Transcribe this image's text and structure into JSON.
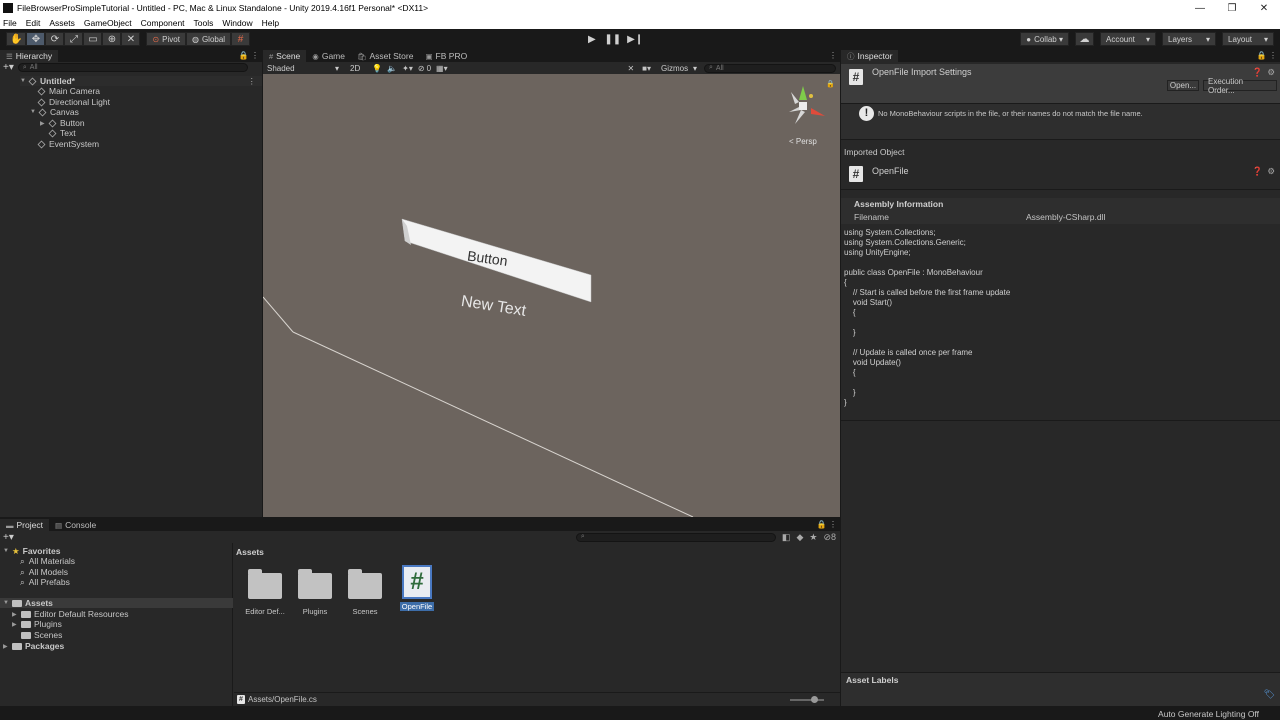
{
  "window": {
    "title": "FileBrowserProSimpleTutorial - Untitled - PC, Mac & Linux Standalone - Unity 2019.4.16f1 Personal* <DX11>",
    "minimize": "—",
    "restore": "❐",
    "close": "✕"
  },
  "menu": [
    "File",
    "Edit",
    "Assets",
    "GameObject",
    "Component",
    "Tools",
    "Window",
    "Help"
  ],
  "toolbar": {
    "pivot": "Pivot",
    "global": "Global",
    "collab": "Collab",
    "account": "Account",
    "layers": "Layers",
    "layout": "Layout"
  },
  "hierarchy": {
    "tab": "Hierarchy",
    "search_placeholder": "All",
    "items": [
      {
        "label": "Untitled*",
        "depth": 0
      },
      {
        "label": "Main Camera",
        "depth": 1
      },
      {
        "label": "Directional Light",
        "depth": 1
      },
      {
        "label": "Canvas",
        "depth": 1
      },
      {
        "label": "Button",
        "depth": 2
      },
      {
        "label": "Text",
        "depth": 2
      },
      {
        "label": "EventSystem",
        "depth": 1
      }
    ]
  },
  "scene": {
    "tabs": [
      "Scene",
      "Game",
      "Asset Store",
      "FB PRO"
    ],
    "shading": "Shaded",
    "mode_2d": "2D",
    "hidden_count": "0",
    "gizmos": "Gizmos",
    "search_placeholder": "All",
    "persp": "< Persp",
    "button_label": "Button",
    "text_label": "New Text"
  },
  "inspector": {
    "tab": "Inspector",
    "title": "OpenFile Import Settings",
    "open_btn": "Open...",
    "exec_btn": "Execution Order...",
    "warning": "No MonoBehaviour scripts in the file, or their names do not match the file name.",
    "imported_object": "Imported Object",
    "object_name": "OpenFile",
    "assembly_info": "Assembly Information",
    "filename_label": "Filename",
    "filename_value": "Assembly-CSharp.dll",
    "code": "using System.Collections;\nusing System.Collections.Generic;\nusing UnityEngine;\n\npublic class OpenFile : MonoBehaviour\n{\n    // Start is called before the first frame update\n    void Start()\n    {\n\n    }\n\n    // Update is called once per frame\n    void Update()\n    {\n\n    }\n}",
    "asset_labels": "Asset Labels"
  },
  "project": {
    "tabs": [
      "Project",
      "Console"
    ],
    "favorites": "Favorites",
    "fav_items": [
      "All Materials",
      "All Models",
      "All Prefabs"
    ],
    "assets_root": "Assets",
    "asset_folders": [
      "Editor Default Resources",
      "Plugins",
      "Scenes"
    ],
    "packages": "Packages",
    "breadcrumb": "Assets",
    "hidden_count": "8",
    "grid": [
      {
        "label": "Editor Def...",
        "type": "folder"
      },
      {
        "label": "Plugins",
        "type": "folder"
      },
      {
        "label": "Scenes",
        "type": "folder"
      },
      {
        "label": "OpenFile",
        "type": "script"
      }
    ],
    "selected_path": "Assets/OpenFile.cs"
  },
  "status": {
    "lighting": "Auto Generate Lighting Off"
  }
}
